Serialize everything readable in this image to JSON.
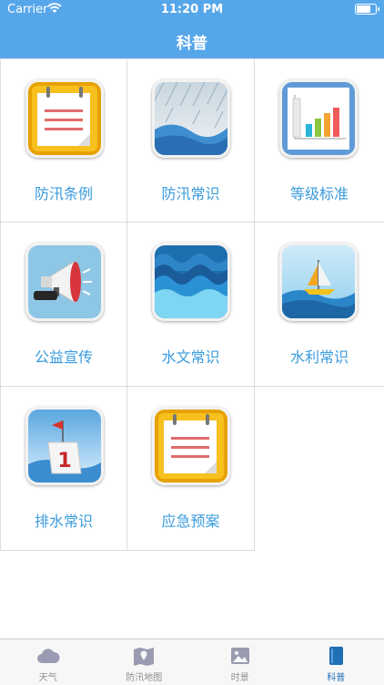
{
  "status": {
    "carrier": "Carrier",
    "time": "11:20 PM"
  },
  "header": {
    "title": "科普"
  },
  "items": [
    {
      "label": "防汛条例",
      "icon": "notepad-icon"
    },
    {
      "label": "防汛常识",
      "icon": "rain-icon"
    },
    {
      "label": "等级标准",
      "icon": "bar-chart-icon"
    },
    {
      "label": "公益宣传",
      "icon": "megaphone-icon"
    },
    {
      "label": "水文常识",
      "icon": "waves-icon"
    },
    {
      "label": "水利常识",
      "icon": "sailboat-icon"
    },
    {
      "label": "排水常识",
      "icon": "flag-marker-icon"
    },
    {
      "label": "应急预案",
      "icon": "notepad-icon"
    }
  ],
  "tabbar": [
    {
      "label": "天气",
      "icon": "cloud-icon"
    },
    {
      "label": "防汛地图",
      "icon": "map-icon"
    },
    {
      "label": "时景",
      "icon": "photo-icon"
    },
    {
      "label": "科普",
      "icon": "book-icon",
      "active": true
    }
  ],
  "colors": {
    "accent": "#56a7ea",
    "label": "#3a9bdc",
    "tab_active": "#1f6fb5"
  }
}
